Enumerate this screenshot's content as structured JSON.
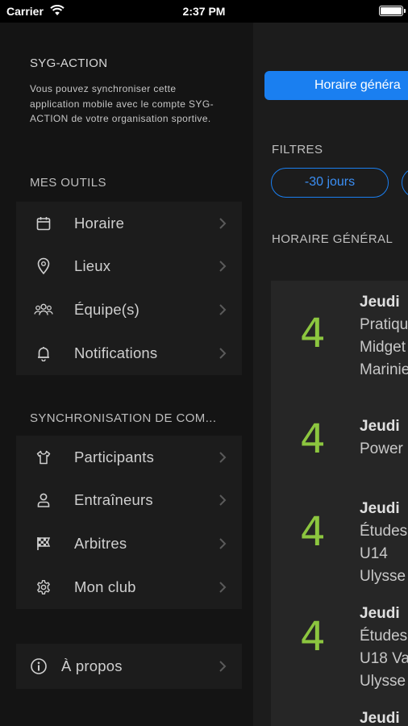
{
  "status_bar": {
    "carrier": "Carrier",
    "time": "2:37 PM"
  },
  "sidebar": {
    "app_title": "SYG-ACTION",
    "description": "Vous pouvez synchroniser cette application mobile avec le compte SYG-ACTION de votre organisation sportive.",
    "tools_title": "MES OUTILS",
    "tools": [
      {
        "label": "Horaire",
        "icon": "calendar-icon"
      },
      {
        "label": "Lieux",
        "icon": "location-pin-icon"
      },
      {
        "label": "Équipe(s)",
        "icon": "team-icon"
      },
      {
        "label": "Notifications",
        "icon": "bell-icon"
      }
    ],
    "sync_title": "SYNCHRONISATION DE COM...",
    "sync_items": [
      {
        "label": "Participants",
        "icon": "jersey-icon"
      },
      {
        "label": "Entraîneurs",
        "icon": "person-icon"
      },
      {
        "label": "Arbitres",
        "icon": "checkered-flag-icon"
      },
      {
        "label": "Mon club",
        "icon": "gear-icon"
      }
    ],
    "about": {
      "label": "À propos",
      "icon": "info-icon"
    }
  },
  "main": {
    "primary_button": "Horaire généra",
    "filters_title": "FILTRES",
    "filter_pill": "-30 jours",
    "schedule_title": "HORAIRE GÉNÉRAL",
    "events": [
      {
        "number": "4",
        "day": "Jeudi",
        "lines": [
          "Pratiqu",
          "Midget",
          "Marinie"
        ]
      },
      {
        "number": "4",
        "day": "Jeudi",
        "lines": [
          "Power"
        ]
      },
      {
        "number": "4",
        "day": "Jeudi",
        "lines": [
          "Études",
          "U14",
          "Ulysse"
        ]
      },
      {
        "number": "4",
        "day": "Jeudi",
        "lines": [
          "Études",
          "U18 Va",
          "Ulysse"
        ]
      },
      {
        "number": "",
        "day": "Jeudi",
        "lines": []
      }
    ]
  },
  "colors": {
    "accent": "#1a7ff0",
    "date_green": "#8cc63f",
    "sidebar_bg": "#141414",
    "group_bg": "#1c1c1c"
  }
}
